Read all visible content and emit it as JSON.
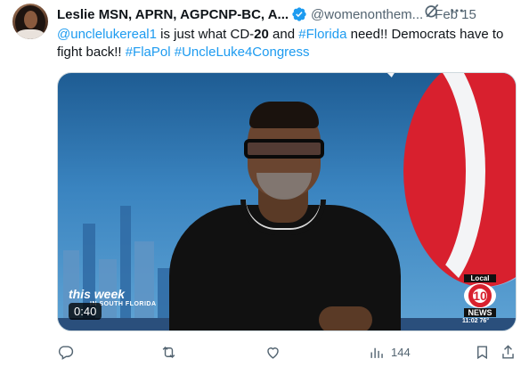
{
  "author": {
    "display_name": "Leslie MSN, APRN, AGPCNP-BC, A...",
    "handle": "@womenonthem...",
    "separator": "·",
    "date": "Feb 15"
  },
  "tweet": {
    "mention": "@unclelukereal1",
    "text_1": " is just what CD-",
    "district_number": "20",
    "text_2": " and ",
    "hashtag_florida": "#Florida",
    "text_3": " need!! Democrats have to fight back!! ",
    "hashtag_flapol": "#FlaPol",
    "hashtag_campaign": "#UncleLuke4Congress"
  },
  "media": {
    "overlay_show": "this week",
    "overlay_show_sub": "IN SOUTH FLORIDA",
    "duration": "0:40",
    "station": {
      "top_label": "Local",
      "number": "10",
      "news_label": "NEWS",
      "time_temp": "11:02  76°"
    }
  },
  "actions": {
    "views_count": "144"
  },
  "icons": {
    "verified": "verified-badge-icon",
    "grok": "grok-icon",
    "more": "more-options-icon",
    "reply": "reply-icon",
    "retweet": "retweet-icon",
    "like": "like-icon",
    "views": "views-icon",
    "bookmark": "bookmark-icon",
    "share": "share-icon"
  },
  "colors": {
    "link": "#1d9bf0",
    "verified": "#1d9bf0",
    "secondary_text": "#536471"
  }
}
